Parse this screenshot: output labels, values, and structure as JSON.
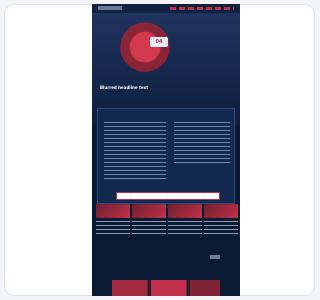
{
  "hero": {
    "badge": "04",
    "headline": "Blurred headline text",
    "sidebar_text": ""
  },
  "dialog": {
    "title_left": "",
    "title_right": "",
    "accept_label": "",
    "reject_label": ""
  },
  "section": {
    "label": ""
  },
  "colors": {
    "page_bg": "#0b1a33",
    "accent": "#c0304a",
    "dialog_bg": "#13284f"
  }
}
